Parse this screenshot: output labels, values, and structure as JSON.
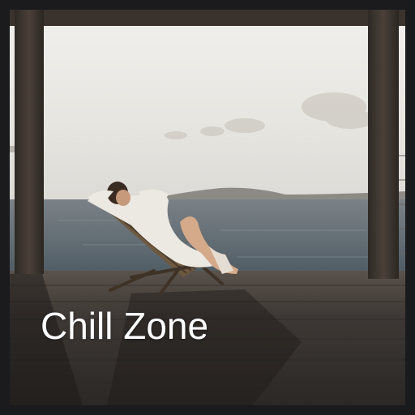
{
  "tile": {
    "title": "Chill Zone",
    "image_description_icon": "photo-man-relaxing-on-deck-chair-by-sea"
  },
  "colors": {
    "frame": "#1b1b1d",
    "sky": "#ebe9e4",
    "sea": "#5d6a72",
    "deck": "#3a3633",
    "title_text": "#ffffff"
  }
}
